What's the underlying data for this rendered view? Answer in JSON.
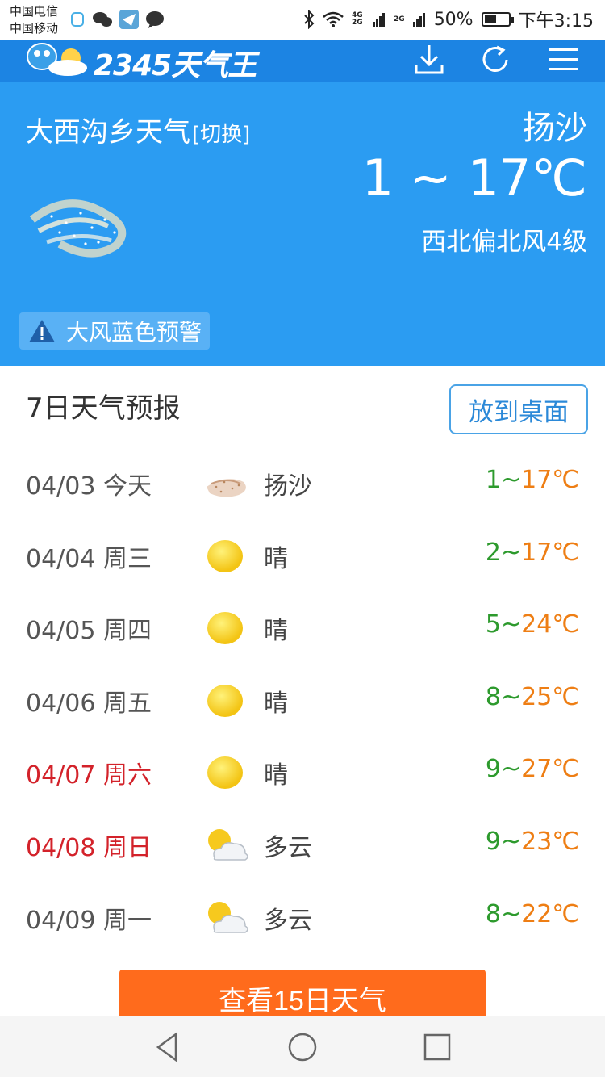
{
  "status_bar": {
    "carrier_1": "中国电信",
    "carrier_2": "中国移动",
    "network_1": "4G 2G",
    "network_2": "2G",
    "battery": "50%",
    "battery_level": 0.5,
    "time": "下午3:15"
  },
  "app": {
    "logo_text": "2345天气王",
    "icons": [
      "download-icon",
      "refresh-icon",
      "menu-icon"
    ]
  },
  "current": {
    "location": "大西沟乡天气",
    "switch_label": "[切换]",
    "condition": "扬沙",
    "temperature": "1 ~ 17℃",
    "wind": "西北偏北风4级",
    "warning": "大风蓝色预警"
  },
  "forecast": {
    "title": "7日天气预报",
    "desktop_button": "放到桌面",
    "days": [
      {
        "date": "04/03 今天",
        "icon": "sand",
        "weather": "扬沙",
        "low": "1",
        "high": "17℃",
        "weekend": false
      },
      {
        "date": "04/04 周三",
        "icon": "sun",
        "weather": "晴",
        "low": "2",
        "high": "17℃",
        "weekend": false
      },
      {
        "date": "04/05 周四",
        "icon": "sun",
        "weather": "晴",
        "low": "5",
        "high": "24℃",
        "weekend": false
      },
      {
        "date": "04/06 周五",
        "icon": "sun",
        "weather": "晴",
        "low": "8",
        "high": "25℃",
        "weekend": false
      },
      {
        "date": "04/07 周六",
        "icon": "sun",
        "weather": "晴",
        "low": "9",
        "high": "27℃",
        "weekend": true
      },
      {
        "date": "04/08 周日",
        "icon": "cloudy",
        "weather": "多云",
        "low": "9",
        "high": "23℃",
        "weekend": true
      },
      {
        "date": "04/09 周一",
        "icon": "cloudy",
        "weather": "多云",
        "low": "8",
        "high": "22℃",
        "weekend": false
      }
    ]
  },
  "view_15_button": "查看15日天气",
  "colors": {
    "header_blue": "#1c84e3",
    "hero_blue": "#2b9cf2",
    "low_temp_green": "#2d9a2d",
    "high_temp_orange": "#ee7e14",
    "weekend_red": "#d3222a",
    "button_orange": "#ff6b1c"
  }
}
